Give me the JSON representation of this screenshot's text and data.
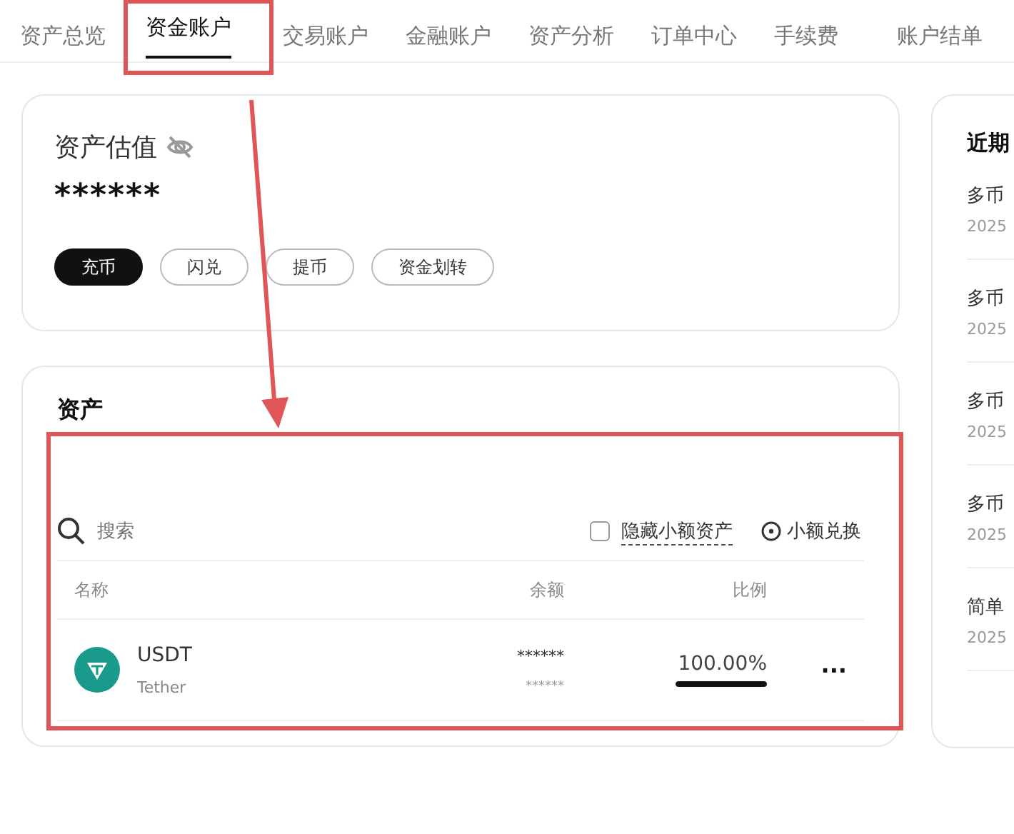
{
  "tabs": [
    {
      "label": "资产总览",
      "selected": false
    },
    {
      "label": "资金账户",
      "selected": true
    },
    {
      "label": "交易账户",
      "selected": false
    },
    {
      "label": "金融账户",
      "selected": false
    },
    {
      "label": "资产分析",
      "selected": false
    },
    {
      "label": "订单中心",
      "selected": false
    },
    {
      "label": "手续费",
      "selected": false
    },
    {
      "label": "账户结单",
      "selected": false
    }
  ],
  "valuation": {
    "title": "资产估值",
    "amount": "******",
    "buttons": [
      {
        "label": "充币",
        "primary": true
      },
      {
        "label": "闪兑",
        "primary": false
      },
      {
        "label": "提币",
        "primary": false
      },
      {
        "label": "资金划转",
        "primary": false
      }
    ]
  },
  "assets": {
    "title": "资产",
    "search": {
      "placeholder": "搜索"
    },
    "hide_small": {
      "label": "隐藏小额资产",
      "checked": false
    },
    "small_convert": "小额兑换",
    "columns": [
      "名称",
      "余额",
      "比例"
    ],
    "rows": [
      {
        "symbol": "USDT",
        "name": "Tether",
        "balance": "******",
        "balance_sub": "******",
        "ratio": "100.00%",
        "level": 1,
        "more": "···"
      }
    ]
  },
  "recent": {
    "title": "近期",
    "items": [
      {
        "title": "多币",
        "date": "2025"
      },
      {
        "title": "多币",
        "date": "2025"
      },
      {
        "title": "多币",
        "date": "2025"
      },
      {
        "title": "多币",
        "date": "2025"
      },
      {
        "title": "简单",
        "date": "2025"
      }
    ]
  }
}
